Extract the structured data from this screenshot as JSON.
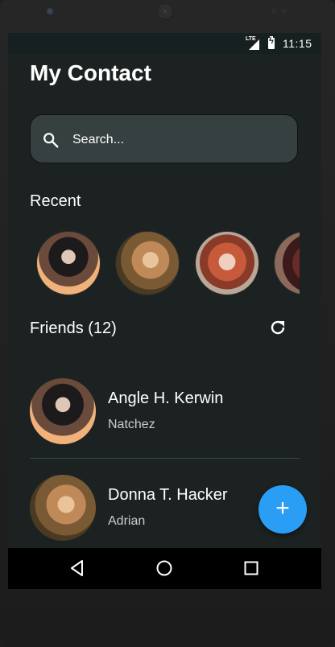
{
  "status_bar": {
    "network": "LTE",
    "time": "11:15"
  },
  "header": {
    "title": "My Contact"
  },
  "search": {
    "placeholder": "Search...",
    "icon": "search-icon"
  },
  "recent": {
    "label": "Recent",
    "avatars": [
      "contact-photo-1",
      "contact-photo-2",
      "contact-photo-3",
      "contact-photo-4"
    ]
  },
  "friends": {
    "label": "Friends (12)",
    "items": [
      {
        "name": "Angle H. Kerwin",
        "subtitle": "Natchez"
      },
      {
        "name": "Donna T. Hacker",
        "subtitle": "Adrian"
      }
    ]
  },
  "fab": {
    "label": "+"
  },
  "colors": {
    "accent": "#2a9df4",
    "background": "#1c2222",
    "search_bg": "#364040"
  }
}
